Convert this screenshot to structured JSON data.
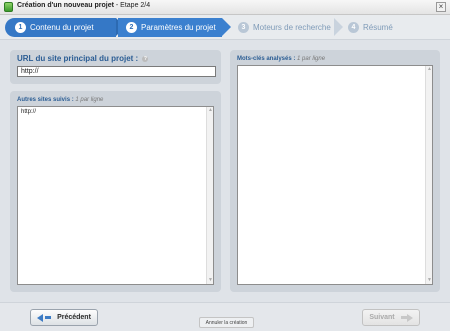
{
  "window": {
    "title": "Création d'un nouveau projet",
    "step_indicator": " - Etape 2/4",
    "close_symbol": "×",
    "icon": "app-icon"
  },
  "steps": [
    {
      "number": "1",
      "label": "Contenu du projet",
      "state": "completed"
    },
    {
      "number": "2",
      "label": "Paramètres du projet",
      "state": "active"
    },
    {
      "number": "3",
      "label": "Moteurs de recherche",
      "state": "inactive"
    },
    {
      "number": "4",
      "label": "Résumé",
      "state": "inactive"
    }
  ],
  "url_panel": {
    "label": "URL du site principal du projet :",
    "help_symbol": "?",
    "value": "http://"
  },
  "sites_panel": {
    "label": "Autres sites suivis :",
    "hint": "1 par ligne",
    "value": "http://"
  },
  "keywords_panel": {
    "label": "Mots-clés analysés :",
    "hint": "1 par ligne",
    "value": ""
  },
  "footer": {
    "prev_label": "Précédent",
    "cancel_label": "Annuler la création",
    "next_label": "Suivant"
  },
  "colors": {
    "accent": "#3578c6",
    "panel": "#cdd3da",
    "label": "#2b5d94"
  }
}
